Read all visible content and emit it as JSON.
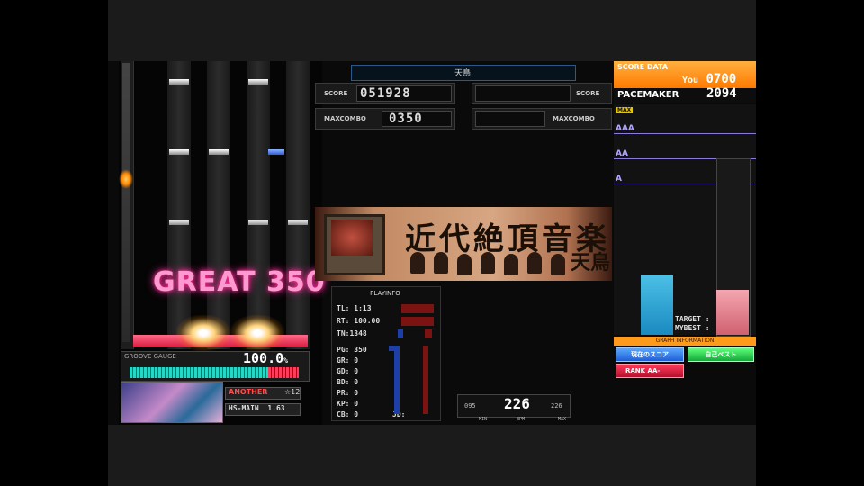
{
  "song": {
    "title": "天鳥",
    "banner_text": "近代絶頂音楽",
    "banner_sub": "天鳥"
  },
  "judge": {
    "text": "GREAT 350"
  },
  "groove": {
    "label": "GROOVE GAUGE",
    "percent": "100.0",
    "percent_unit": "%",
    "gauge_fraction": 1.0
  },
  "chart_info": {
    "difficulty": "ANOTHER",
    "level": "☆12",
    "hs_label": "HS-MAIN",
    "hs_value": "1.63"
  },
  "score_panel": {
    "score_label": "SCORE",
    "score_value": "051928",
    "maxcombo_label": "MAXCOMBO",
    "maxcombo_value": "0350",
    "rival_score_label": "SCORE",
    "rival_maxcombo_label": "MAXCOMBO"
  },
  "playinfo": {
    "title": "PLAYINFO",
    "tl": "TL: 1:13",
    "rt": "RT: 100.00",
    "tn": "TN:1348",
    "pg": "PG:  350",
    "gr": "GR:    0",
    "gd": "GD:    0",
    "bd": "BD:    0",
    "pr": "PR:    0",
    "kp": "KP:    0",
    "cb": "CB:    0",
    "jd": "JD:"
  },
  "bpm": {
    "min": "095",
    "current": "226",
    "max": "226",
    "min_label": "MIN",
    "bpm_label": "BPM",
    "max_label": "MAX"
  },
  "score_data": {
    "title": "SCORE DATA",
    "you_label": "You",
    "you_value": "0700",
    "pacemaker_label": "PACEMAKER",
    "pacemaker_value": "2094",
    "max_badge": "MAX",
    "grade_lines": [
      "AAA",
      "AA",
      "A"
    ],
    "target_label": "TARGET :",
    "mybest_label": "MYBEST :",
    "graph_info": "GRAPH INFORMATION",
    "button_left": "現在のスコア",
    "button_right": "自己ベスト",
    "rank_label": "RANK AA-"
  },
  "colors": {
    "accent": "#ff8a00",
    "gauge": "#27d6c4",
    "judge": "#ff9ad0",
    "grade_line": "#8a7cd8"
  }
}
